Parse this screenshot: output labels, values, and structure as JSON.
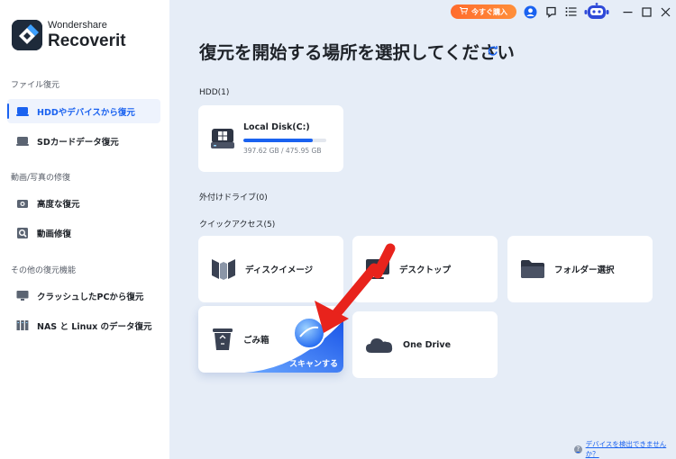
{
  "app": {
    "brand": "Wondershare",
    "name": "Recoverit"
  },
  "topbar": {
    "buy_label": "今すぐ購入"
  },
  "sidebar": {
    "sections": [
      {
        "title": "ファイル復元"
      },
      {
        "title": "動画/写真の修復"
      },
      {
        "title": "その他の復元機能"
      }
    ],
    "items": [
      {
        "label": "HDDやデバイスから復元",
        "icon": "hdd-icon",
        "active": true
      },
      {
        "label": "SDカードデータ復元",
        "icon": "sd-card-icon"
      },
      {
        "label": "高度な復元",
        "icon": "camera-icon"
      },
      {
        "label": "動画修復",
        "icon": "video-repair-icon"
      },
      {
        "label": "クラッシュしたPCから復元",
        "icon": "monitor-icon"
      },
      {
        "label": "NAS と Linux のデータ復元",
        "icon": "nas-icon"
      }
    ]
  },
  "main": {
    "title": "復元を開始する場所を選択してください",
    "hdd_group": "HDD(1)",
    "disk": {
      "name": "Local Disk(C:)",
      "size": "397.62 GB / 475.95 GB",
      "used_fraction": 0.835
    },
    "external_group": "外付けドライブ(0)",
    "quick_group": "クイックアクセス(5)",
    "quick_items": [
      {
        "label": "ディスクイメージ",
        "icon": "disk-image-icon"
      },
      {
        "label": "デスクトップ",
        "icon": "desktop-icon"
      },
      {
        "label": "フォルダー選択",
        "icon": "folder-icon"
      },
      {
        "label": "ごみ箱",
        "icon": "trash-icon"
      },
      {
        "label": "One Drive",
        "icon": "onedrive-icon"
      }
    ],
    "scan_label": "スキャンする"
  },
  "footer": {
    "help_link": "デバイスを検出できませんか？"
  },
  "colors": {
    "accent": "#1a62f0",
    "buy": "#ff7a32",
    "arrow": "#e8231c"
  }
}
